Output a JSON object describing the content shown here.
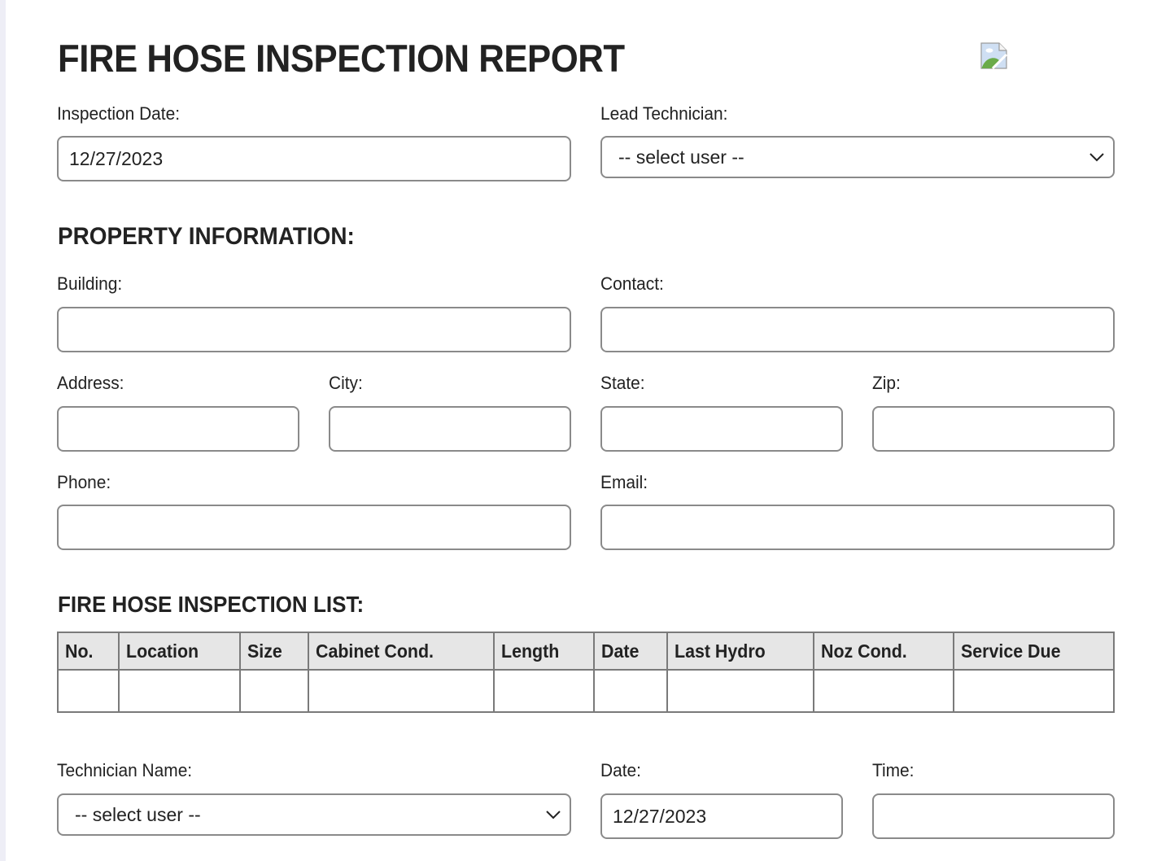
{
  "title": "FIRE HOSE INSPECTION REPORT",
  "logo": {
    "icon": "broken-image-icon"
  },
  "header_fields": {
    "inspection_date": {
      "label": "Inspection Date:",
      "value": "12/27/2023"
    },
    "lead_technician": {
      "label": "Lead Technician:",
      "selected": "-- select user --"
    }
  },
  "property": {
    "section_title": "PROPERTY INFORMATION:",
    "building": {
      "label": "Building:",
      "value": ""
    },
    "contact": {
      "label": "Contact:",
      "value": ""
    },
    "address": {
      "label": "Address:",
      "value": ""
    },
    "city": {
      "label": "City:",
      "value": ""
    },
    "state": {
      "label": "State:",
      "value": ""
    },
    "zip": {
      "label": "Zip:",
      "value": ""
    },
    "phone": {
      "label": "Phone:",
      "value": ""
    },
    "email": {
      "label": "Email:",
      "value": ""
    }
  },
  "inspection_list": {
    "section_title": "FIRE HOSE INSPECTION LIST:",
    "columns": [
      "No.",
      "Location",
      "Size",
      "Cabinet Cond.",
      "Length",
      "Date",
      "Last Hydro",
      "Noz Cond.",
      "Service Due"
    ],
    "rows": [
      [
        "",
        "",
        "",
        "",
        "",
        "",
        "",
        "",
        ""
      ]
    ]
  },
  "signoff": {
    "technician_name": {
      "label": "Technician Name:",
      "selected": "-- select user --"
    },
    "date": {
      "label": "Date:",
      "value": "12/27/2023"
    },
    "time": {
      "label": "Time:",
      "value": ""
    }
  }
}
